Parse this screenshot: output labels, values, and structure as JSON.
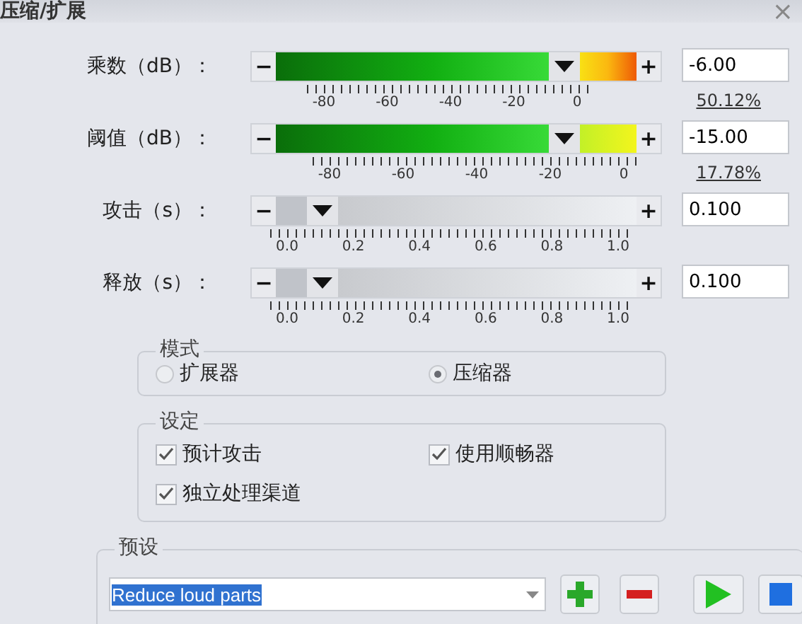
{
  "window": {
    "title": "压缩/扩展",
    "close": "×"
  },
  "sliders": [
    {
      "kind": "gain",
      "label": "乘数（dB）：",
      "decrease": "−",
      "increase": "+",
      "level": 0.8,
      "scale": [
        "-80",
        "-60",
        "-40",
        "-20",
        "0"
      ],
      "value": "-6.00",
      "percent": "50.12%"
    },
    {
      "kind": "threshold",
      "label": "阈值（dB）：",
      "decrease": "−",
      "increase": "+",
      "level": 0.8,
      "scale": [
        "-80",
        "-60",
        "-40",
        "-20",
        "0"
      ],
      "value": "-15.00",
      "percent": "17.78%"
    },
    {
      "kind": "time",
      "label": "攻击（s）：",
      "decrease": "−",
      "increase": "+",
      "level": 0.13,
      "scale": [
        "0.0",
        "0.2",
        "0.4",
        "0.6",
        "0.8",
        "1.0"
      ],
      "value": "0.100"
    },
    {
      "kind": "time",
      "label": "释放（s）：",
      "decrease": "−",
      "increase": "+",
      "level": 0.13,
      "scale": [
        "0.0",
        "0.2",
        "0.4",
        "0.6",
        "0.8",
        "1.0"
      ],
      "value": "0.100"
    }
  ],
  "mode": {
    "title": "模式",
    "options": [
      {
        "label": "扩展器",
        "selected": false
      },
      {
        "label": "压缩器",
        "selected": true
      }
    ]
  },
  "settings": {
    "title": "设定",
    "options": [
      {
        "label": "预计攻击",
        "checked": true
      },
      {
        "label": "使用顺畅器",
        "checked": true
      },
      {
        "label": "独立处理渠道",
        "checked": true
      }
    ]
  },
  "presets": {
    "title": "预设",
    "value": "Reduce loud parts"
  }
}
